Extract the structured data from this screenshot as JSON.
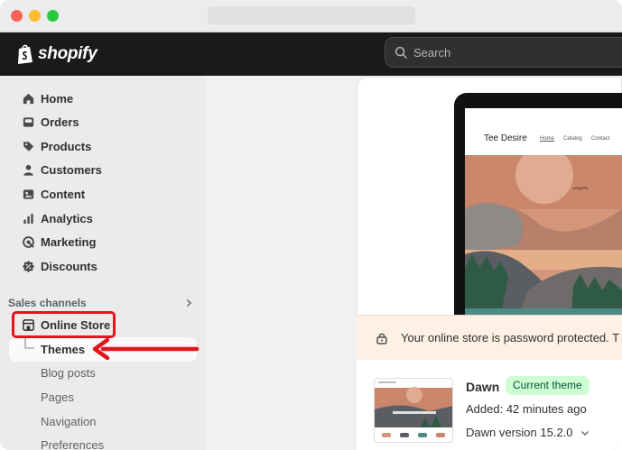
{
  "brand": {
    "name": "shopify"
  },
  "search": {
    "placeholder": "Search"
  },
  "sidebar": {
    "items": [
      {
        "label": "Home",
        "icon": "home-icon"
      },
      {
        "label": "Orders",
        "icon": "orders-icon"
      },
      {
        "label": "Products",
        "icon": "tag-icon"
      },
      {
        "label": "Customers",
        "icon": "person-icon"
      },
      {
        "label": "Content",
        "icon": "content-icon"
      },
      {
        "label": "Analytics",
        "icon": "bar-chart-icon"
      },
      {
        "label": "Marketing",
        "icon": "target-icon"
      },
      {
        "label": "Discounts",
        "icon": "discount-icon"
      }
    ],
    "section_title": "Sales channels",
    "channel": {
      "label": "Online Store",
      "icon": "store-icon"
    },
    "sub_items": [
      "Themes",
      "Blog posts",
      "Pages",
      "Navigation",
      "Preferences"
    ]
  },
  "preview": {
    "store_name": "Tee Desire",
    "nav": [
      "Home",
      "Catalog",
      "Contact"
    ]
  },
  "banner": {
    "text": "Your online store is password protected. T"
  },
  "theme": {
    "name": "Dawn",
    "badge": "Current theme",
    "added": "Added: 42 minutes ago",
    "version": "Dawn version 15.2.0"
  },
  "colors": {
    "topbar": "#1a1a1a",
    "badge_bg": "#cdfed4",
    "annotation_red": "#e2141c",
    "banner_bg": "#fdf0e4"
  }
}
